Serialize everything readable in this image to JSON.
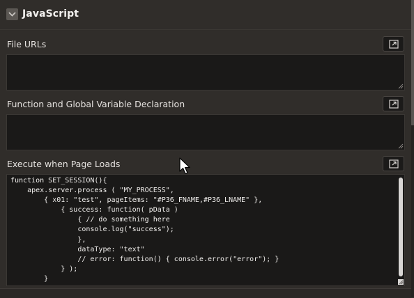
{
  "region": {
    "title": "JavaScript",
    "toggle_icon": "chevron-down-icon"
  },
  "fields": {
    "file_urls": {
      "label": "File URLs",
      "value": ""
    },
    "function_declaration": {
      "label": "Function and Global Variable Declaration",
      "value": ""
    },
    "execute_on_load": {
      "label": "Execute when Page Loads",
      "value": "function SET_SESSION(){\n    apex.server.process ( \"MY_PROCESS\",\n        { x01: \"test\", pageItems: \"#P36_FNAME,#P36_LNAME\" },\n            { success: function( pData )\n                { // do something here\n                console.log(\"success\");\n                },\n                dataType: \"text\"\n                // error: function() { console.error(\"error\"); }\n            } );\n        }"
    }
  },
  "icons": {
    "expand": "expand-icon",
    "resize": "resize-grip-icon",
    "pointer": "mouse-pointer-icon"
  },
  "colors": {
    "background": "#302d2a",
    "field_background": "#1a1918",
    "text": "#f0eeec"
  }
}
